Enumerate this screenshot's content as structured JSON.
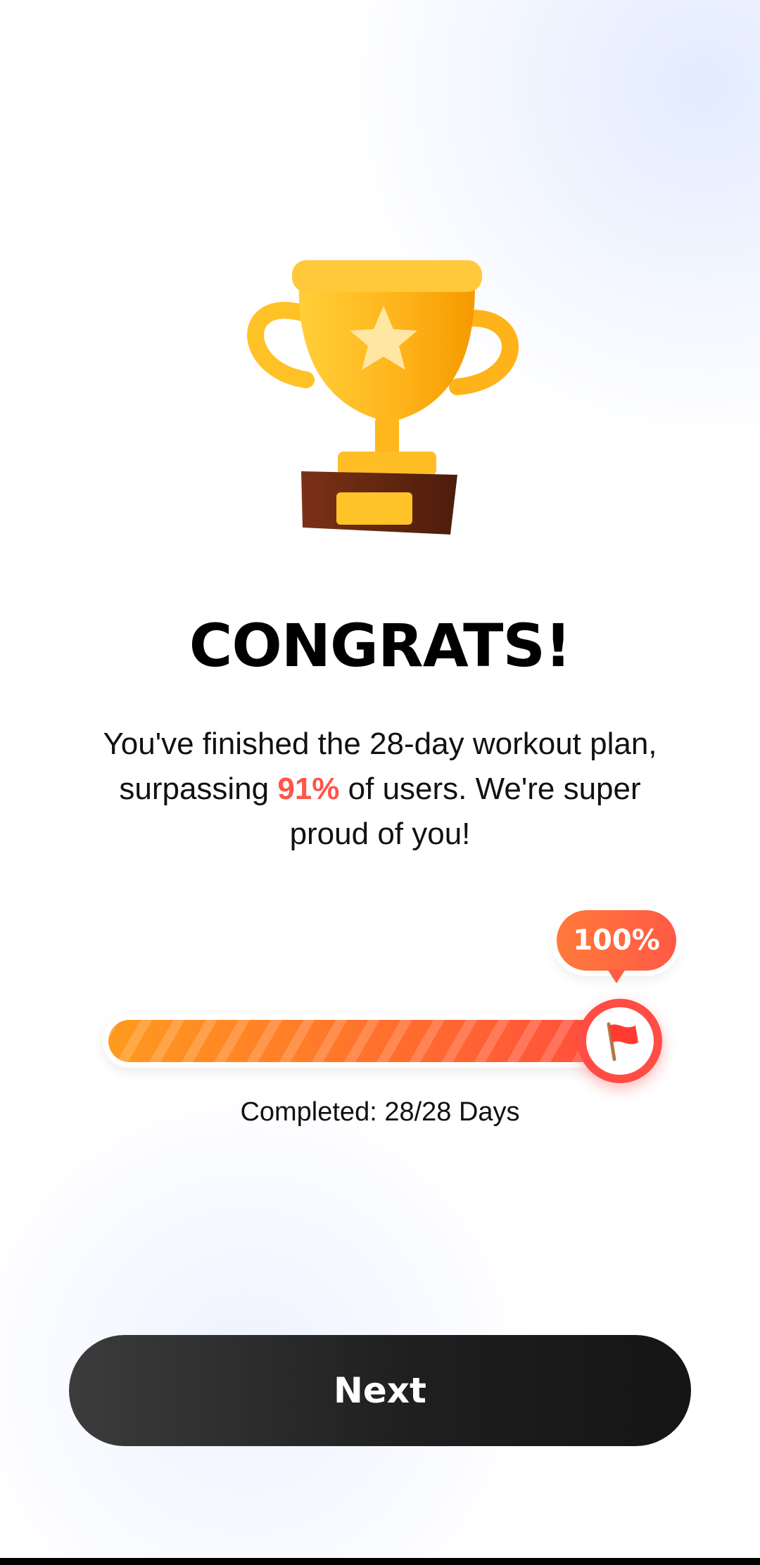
{
  "congrats": {
    "title": "CONGRATS!",
    "message_part1": "You've finished the 28-day workout plan, surpassing ",
    "message_highlight": "91%",
    "message_part2": " of users. We're super proud of you!"
  },
  "progress": {
    "percent_label": "100%",
    "fraction": 1.0,
    "completed_label": "Completed: 28/28 Days"
  },
  "actions": {
    "next_label": "Next"
  },
  "icons": {
    "trophy": "trophy-icon",
    "flag": "flag-icon"
  },
  "colors": {
    "accent": "#ff5548",
    "progress_start": "#ff9a1e",
    "progress_end": "#ff4b40",
    "button": "#1f1f1f"
  }
}
